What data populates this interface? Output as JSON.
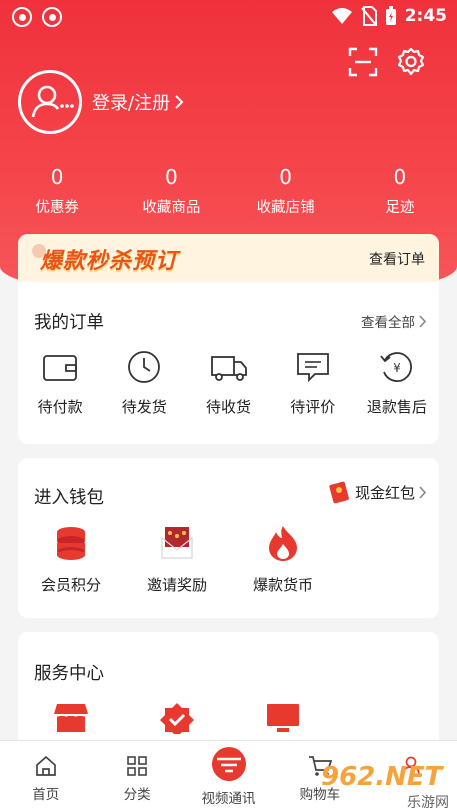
{
  "status_bar": {
    "time": "2:45"
  },
  "header": {
    "login_label": "登录/注册"
  },
  "stats": [
    {
      "value": "0",
      "label": "优惠券"
    },
    {
      "value": "0",
      "label": "收藏商品"
    },
    {
      "value": "0",
      "label": "收藏店铺"
    },
    {
      "value": "0",
      "label": "足迹"
    }
  ],
  "promo": {
    "title": "爆款秒杀预订",
    "link": "查看订单"
  },
  "orders": {
    "title": "我的订单",
    "more": "查看全部",
    "items": [
      {
        "label": "待付款",
        "icon": "wallet-icon"
      },
      {
        "label": "待发货",
        "icon": "clock-icon"
      },
      {
        "label": "待收货",
        "icon": "truck-icon"
      },
      {
        "label": "待评价",
        "icon": "comment-icon"
      },
      {
        "label": "退款售后",
        "icon": "refund-icon"
      }
    ]
  },
  "wallet": {
    "title": "进入钱包",
    "more": "现金红包",
    "items": [
      {
        "label": "会员积分",
        "icon": "coins-icon"
      },
      {
        "label": "邀请奖励",
        "icon": "gift-envelope-icon"
      },
      {
        "label": "爆款货币",
        "icon": "flame-icon"
      }
    ]
  },
  "services": {
    "title": "服务中心"
  },
  "tabbar": [
    {
      "label": "首页",
      "icon": "home-icon"
    },
    {
      "label": "分类",
      "icon": "category-icon"
    },
    {
      "label": "视频通讯",
      "icon": "brand-logo-icon"
    },
    {
      "label": "购物车",
      "icon": "cart-icon"
    }
  ],
  "colors": {
    "primary": "#f0313b",
    "promo_bg": "#fff4df",
    "promo_text": "#e8551b"
  },
  "watermark": {
    "text": "962.NET",
    "sub": "乐游网"
  }
}
